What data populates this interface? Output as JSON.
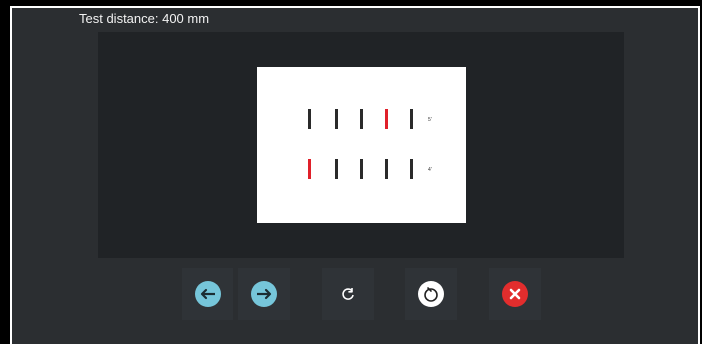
{
  "header": {
    "test_distance": "Test distance: 400 mm"
  },
  "chart_card": {
    "rows": [
      {
        "label": "5'",
        "highlighted_index": 3,
        "tick_count": 5
      },
      {
        "label": "4'",
        "highlighted_index": 0,
        "tick_count": 5
      }
    ],
    "colors": {
      "tick": "#2a2a2a",
      "highlight": "#e0202a"
    }
  },
  "toolbar": {
    "buttons": [
      {
        "name": "previous-button",
        "icon": "arrow-left-icon"
      },
      {
        "name": "next-button",
        "icon": "arrow-right-icon"
      },
      {
        "name": "refresh-button",
        "icon": "refresh-icon"
      },
      {
        "name": "reset-button",
        "icon": "reset-dial-icon"
      },
      {
        "name": "close-button",
        "icon": "close-icon"
      }
    ]
  }
}
